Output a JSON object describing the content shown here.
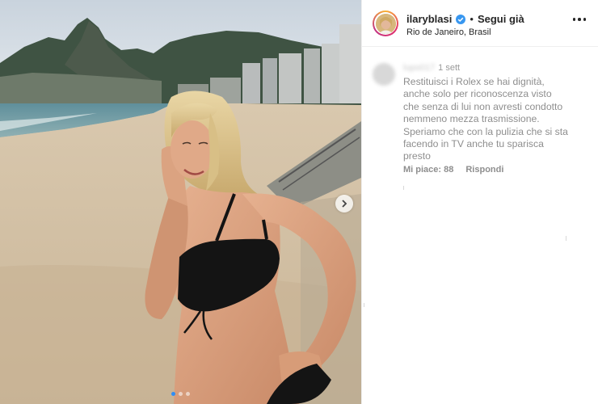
{
  "header": {
    "username": "ilaryblasi",
    "separator": "•",
    "follow_label": "Segui già",
    "location": "Rio de Janeiro, Brasil"
  },
  "comment": {
    "username": "lupo017",
    "time": "1 sett",
    "text": "Restituisci i Rolex se hai dignità, anche solo per riconoscenza visto che senza di lui non avresti condotto nemmeno mezza trasmissione. Speriamo che con la pulizia che si sta facendo in TV anche tu sparisca presto",
    "likes_label": "Mi piace: 88",
    "reply_label": "Rispondi"
  },
  "carousel": {
    "total": 3,
    "active_index": 0
  },
  "colors": {
    "verified": "#3897f0",
    "active_dot": "#2f8df5",
    "text": "#262626",
    "muted": "#8e8e8e"
  },
  "icons": {
    "verified": "verified-badge-icon",
    "more": "more-options-icon",
    "next": "chevron-right-icon"
  }
}
